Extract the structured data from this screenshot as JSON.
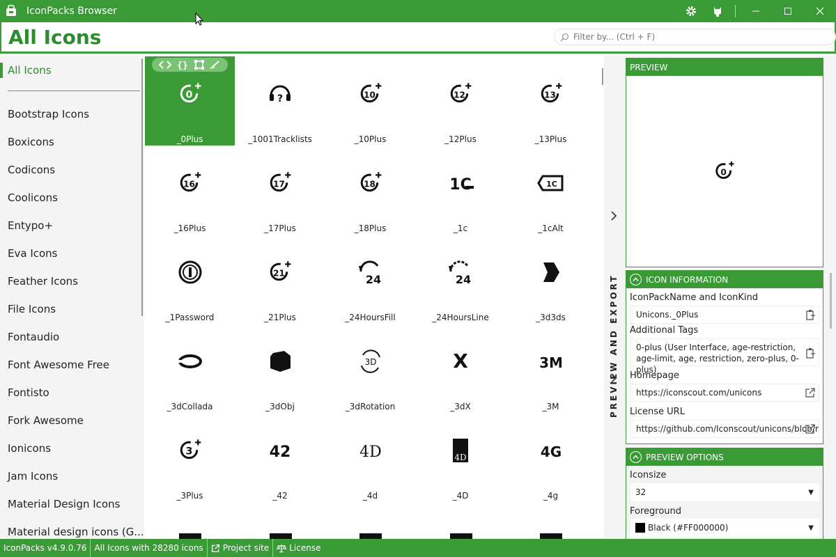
{
  "window": {
    "title": "IconPacks Browser"
  },
  "header": {
    "title": "All Icons",
    "filter_placeholder": "Filter by... (Ctrl + F)"
  },
  "sidebar": {
    "selected": "All Icons",
    "items": [
      "Bootstrap Icons",
      "Boxicons",
      "Codicons",
      "Coolicons",
      "Entypo+",
      "Eva Icons",
      "Feather Icons",
      "File Icons",
      "Fontaudio",
      "Font Awesome Free",
      "Fontisto",
      "Fork Awesome",
      "Ionicons",
      "Jam Icons",
      "Material Design Icons",
      "Material design icons (G..."
    ]
  },
  "grid": {
    "labels": [
      "_0Plus",
      "_1001Tracklists",
      "_10Plus",
      "_12Plus",
      "_13Plus",
      "_16Plus",
      "_17Plus",
      "_18Plus",
      "_1c",
      "_1cAlt",
      "_1Password",
      "_21Plus",
      "_24HoursFill",
      "_24HoursLine",
      "_3d3ds",
      "_3dCollada",
      "_3dObj",
      "_3dRotation",
      "_3dX",
      "_3M",
      "_3Plus",
      "_42",
      "_4d",
      "_4D",
      "_4g"
    ],
    "glyphs": [
      "0",
      "?",
      "10",
      "12",
      "13",
      "16",
      "17",
      "18",
      "1C",
      "1C",
      "1",
      "21",
      "24",
      "24",
      "",
      "",
      "",
      "3D",
      "X",
      "3M",
      "3",
      "42",
      "4D",
      "4D",
      "4G"
    ]
  },
  "expander": {
    "label": "PREVIEW AND EXPORT"
  },
  "preview": {
    "header": "PREVIEW",
    "glyph": "0"
  },
  "info": {
    "header": "ICON INFORMATION",
    "name_label": "IconPackName and IconKind",
    "name_value": "Unicons._0Plus",
    "tags_label": "Additional Tags",
    "tags_value": "0-plus (User Interface, age-restriction, age-limit, age, restriction, zero-plus, 0-plus)",
    "homepage_label": "Homepage",
    "homepage_value": "https://iconscout.com/unicons",
    "license_label": "License URL",
    "license_value": "https://github.com/Iconscout/unicons/blob/r"
  },
  "options": {
    "header": "PREVIEW OPTIONS",
    "iconsize_label": "Iconsize",
    "iconsize_value": "32",
    "foreground_label": "Foreground",
    "foreground_value": "Black (#FF000000)"
  },
  "status": {
    "version": "IconPacks v4.9.0.76",
    "count": "All Icons with 28280 icons",
    "project": "Project site",
    "license": "License"
  },
  "colors": {
    "accent": "#3a9b36"
  }
}
